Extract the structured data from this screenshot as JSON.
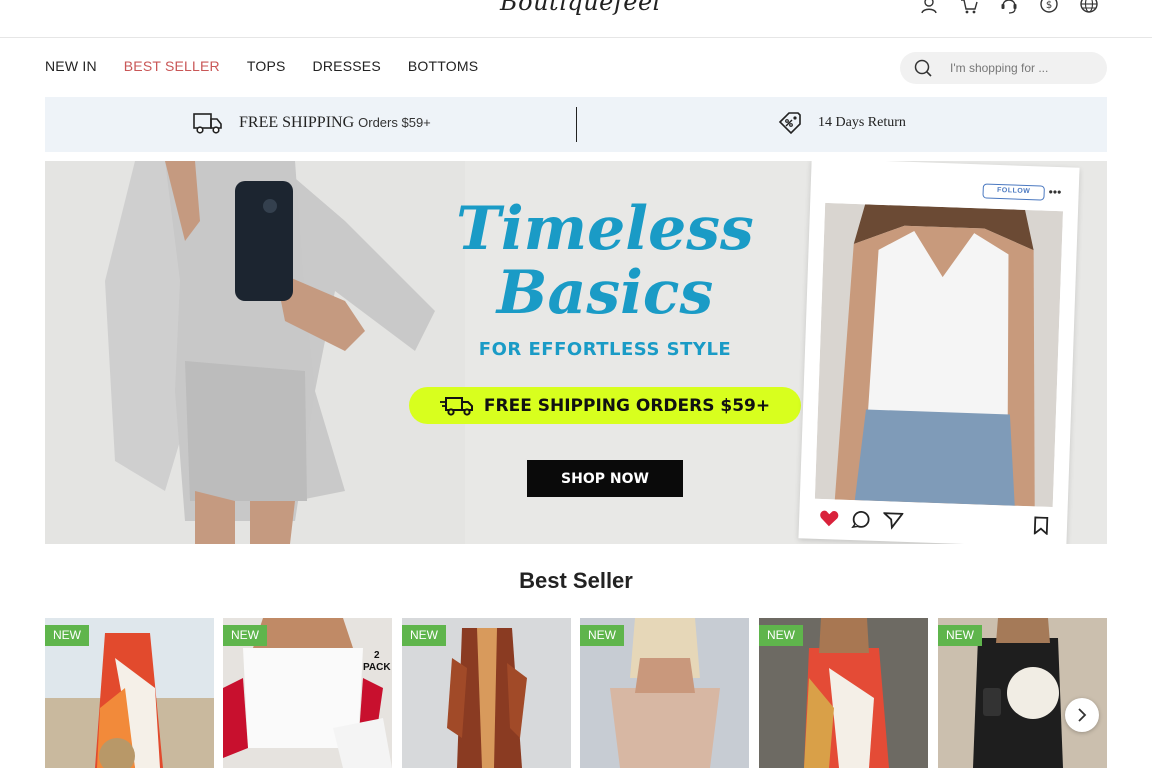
{
  "header": {
    "logo_text": "Boutiquefeel",
    "icons": [
      "user-icon",
      "cart-icon",
      "headset-icon",
      "currency-icon",
      "globe-icon"
    ]
  },
  "nav": {
    "items": [
      {
        "label": "NEW IN",
        "active": false
      },
      {
        "label": "BEST SELLER",
        "active": true
      },
      {
        "label": "TOPS",
        "active": false
      },
      {
        "label": "DRESSES",
        "active": false
      },
      {
        "label": "BOTTOMS",
        "active": false
      }
    ],
    "active_color": "#c95757"
  },
  "search": {
    "placeholder": "I'm shopping for ..."
  },
  "shipping_band": {
    "left_big": "FREE SHIPPING",
    "left_small": "Orders $59+",
    "right_text": "14 Days Return"
  },
  "hero": {
    "title_line1": "Timeless",
    "title_line2": "Basics",
    "subtitle": "FOR EFFORTLESS STYLE",
    "pill_text": "FREE SHIPPING ORDERS $59+",
    "cta_label": "SHOP NOW",
    "follow_label": "FOLLOW",
    "more_label": "•••",
    "accent_color": "#1a9bc6",
    "pill_color": "#d8ff1e"
  },
  "best_seller": {
    "title": "Best Seller",
    "products": [
      {
        "badge": "NEW"
      },
      {
        "badge": "NEW"
      },
      {
        "badge": "NEW"
      },
      {
        "badge": "NEW"
      },
      {
        "badge": "NEW"
      },
      {
        "badge": "NEW"
      }
    ],
    "pack_label_line1": "2",
    "pack_label_line2": "PACK",
    "badge_color": "#5fb54c"
  }
}
